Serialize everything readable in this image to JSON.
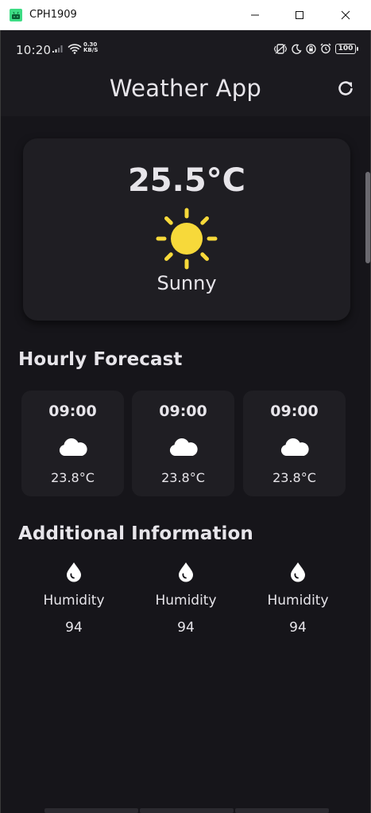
{
  "window": {
    "title": "CPH1909"
  },
  "status_bar": {
    "time": "10:20",
    "speed_value": "0.30",
    "speed_unit": "KB/S",
    "battery": "100"
  },
  "app_bar": {
    "title": "Weather App",
    "refresh_icon": "refresh-icon"
  },
  "current": {
    "temperature": "25.5°C",
    "condition": "Sunny",
    "icon": "sun-icon",
    "icon_color": "#f7d93a"
  },
  "hourly": {
    "title": "Hourly Forecast",
    "items": [
      {
        "time": "09:00",
        "temp": "23.8°C",
        "icon": "cloud-icon"
      },
      {
        "time": "09:00",
        "temp": "23.8°C",
        "icon": "cloud-icon"
      },
      {
        "time": "09:00",
        "temp": "23.8°C",
        "icon": "cloud-icon"
      }
    ]
  },
  "additional": {
    "title": "Additional Information",
    "items": [
      {
        "label": "Humidity",
        "value": "94",
        "icon": "water-drop-icon"
      },
      {
        "label": "Humidity",
        "value": "94",
        "icon": "water-drop-icon"
      },
      {
        "label": "Humidity",
        "value": "94",
        "icon": "water-drop-icon"
      }
    ]
  },
  "colors": {
    "background": "#16151a",
    "card": "#1f1e23",
    "text": "#e7e5ea",
    "sun": "#f7d93a"
  }
}
